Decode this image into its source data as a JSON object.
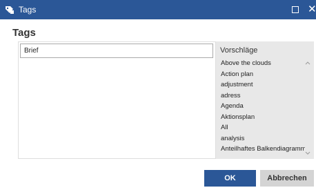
{
  "window": {
    "title": "Tags"
  },
  "dialog": {
    "heading": "Tags",
    "input_value": "Brief"
  },
  "suggestions": {
    "header": "Vorschläge",
    "items": [
      "Above the clouds",
      "Action plan",
      "adjustment",
      "adress",
      "Agenda",
      "Aktionsplan",
      "All",
      "analysis",
      "Anteilhaftes Balkendiagramm"
    ]
  },
  "buttons": {
    "ok_label": "OK",
    "cancel_label": "Abbrechen"
  },
  "colors": {
    "accent": "#2b5797",
    "panel": "#e8e8e8"
  },
  "icons": {
    "app": "tags-app-icon",
    "maximize": "maximize-icon",
    "close": "close-icon"
  }
}
